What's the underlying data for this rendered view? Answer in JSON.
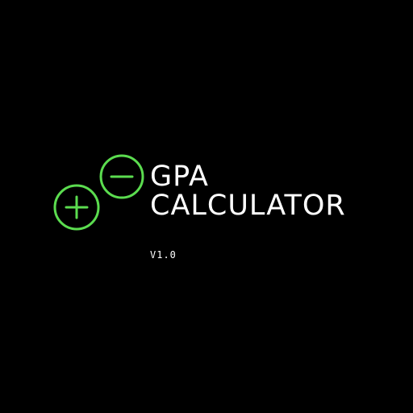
{
  "splash": {
    "title_line_1": "GPA",
    "title_line_2": "CALCULATOR",
    "version": "V1.0"
  },
  "colors": {
    "background": "#000000",
    "accent": "#5bdc4f",
    "text": "#ffffff"
  },
  "icons": {
    "plus": "plus-circle-icon",
    "minus": "minus-circle-icon"
  }
}
